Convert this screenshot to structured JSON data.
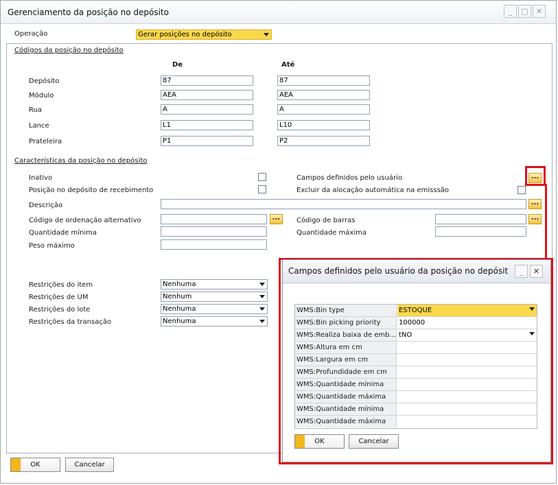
{
  "window": {
    "title": "Gerenciamento da posição no depósito",
    "buttons": [
      "_",
      "□",
      "✕"
    ]
  },
  "operation": {
    "label": "Operação",
    "value": "Gerar posições no depósito"
  },
  "codes": {
    "section": "Códigos da posição no depósito",
    "from_header": "De",
    "to_header": "Até",
    "rows": [
      {
        "label": "Depósito",
        "from": "87",
        "to": "87"
      },
      {
        "label": "Módulo",
        "from": "AEA",
        "to": "AEA"
      },
      {
        "label": "Rua",
        "from": "A",
        "to": "A"
      },
      {
        "label": "Lance",
        "from": "L1",
        "to": "L10"
      },
      {
        "label": "Prateleira",
        "from": "P1",
        "to": "P2"
      }
    ]
  },
  "characteristics": {
    "section": "Características da posição no depósito",
    "inactive": "Inativo",
    "receiving_bin": "Posição no depósito de recebimento",
    "udf": "Campos definidos pelo usuário",
    "exclude_auto": "Excluir da alocação automática na emisssão",
    "description": "Descrição",
    "alt_sort_code": "Código de ordenação alternativo",
    "barcode": "Código de barras",
    "min_qty": "Quantidade mínima",
    "max_qty": "Quantidade máxima",
    "max_weight": "Peso máximo",
    "dots": "..."
  },
  "restrictions": [
    {
      "label": "Restrições do item",
      "value": "Nenhuma"
    },
    {
      "label": "Restrições de UM",
      "value": "Nenhum"
    },
    {
      "label": "Restrições do lote",
      "value": "Nenhuma"
    },
    {
      "label": "Restrições da transação",
      "value": "Nenhuma"
    }
  ],
  "footer": {
    "ok": "OK",
    "cancel": "Cancelar"
  },
  "popup": {
    "title": "Campos definidos pelo usuário da posição no depósit",
    "rows": [
      {
        "key": "WMS:Bin type",
        "value": "ESTOQUE"
      },
      {
        "key": "WMS:Bin picking priority",
        "value": "100000"
      },
      {
        "key": "WMS:Realiza baixa de emb...",
        "value": "tNO"
      },
      {
        "key": "WMS:Altura em cm",
        "value": ""
      },
      {
        "key": "WMS:Largura em cm",
        "value": ""
      },
      {
        "key": "WMS:Profundidade em cm",
        "value": ""
      },
      {
        "key": "WMS:Quantidade mínima",
        "value": ""
      },
      {
        "key": "WMS:Quantidade máxima",
        "value": ""
      },
      {
        "key": "WMS:Quantidade mínima",
        "value": ""
      },
      {
        "key": "WMS:Quantidade máxima",
        "value": ""
      }
    ],
    "ok": "OK",
    "cancel": "Cancelar"
  },
  "colors": {
    "highlight": "#e0101a",
    "accent_yellow": "#fbd84a",
    "button_bar": "#f3b61d"
  }
}
